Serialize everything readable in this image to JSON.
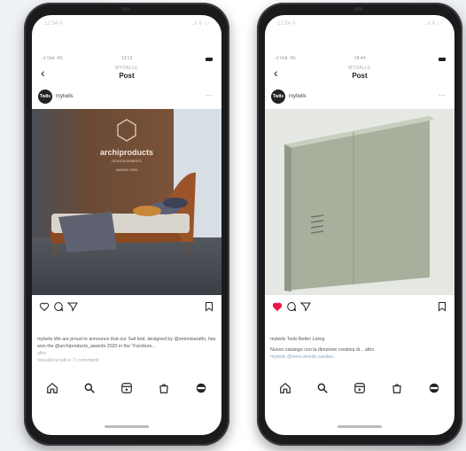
{
  "phones": [
    {
      "outer_status": {
        "left": "12:54 ⚲",
        "right": "..ıl ⚲ ▭"
      },
      "inner_status": {
        "left": "..ıl Vod. 4G",
        "center": "13:13"
      },
      "nav": {
        "account": "MYDALLE",
        "title": "Post"
      },
      "post": {
        "avatar_text": "Twils",
        "username": "mytwils",
        "photo_brand": "archiproducts",
        "photo_sub": "DESIGN AWARDS",
        "photo_badge": "AWARD 2020",
        "liked": false,
        "caption": "mytwils We are proud to announce that our Sail bed, designed by @zetonisarafin, has won the @archiproducts_awards 2020 in the \"Furniture...",
        "caption_more": "altro",
        "comments": "Visualizza tutti e 7 i commenti"
      },
      "tabs": [
        "home-icon",
        "search-icon",
        "reels-icon",
        "shop-icon",
        "profile-icon"
      ]
    },
    {
      "outer_status": {
        "left": "12:54 ⚲",
        "right": "..ıl ⚲ ▭"
      },
      "inner_status": {
        "left": "..ıl Vod. 4G",
        "center": "18:44"
      },
      "nav": {
        "account": "MYDALLE",
        "title": "Post"
      },
      "post": {
        "avatar_text": "Twils",
        "username": "mytwils",
        "liked": true,
        "likes_line": "mytwils Twils Better Living",
        "caption": "Nuovo catalogo con la direzione creativa di... altro",
        "caption2": "mytwils @novo.arredo.sanitari..."
      },
      "tabs": [
        "home-icon",
        "search-icon",
        "reels-icon",
        "shop-icon",
        "profile-icon"
      ]
    }
  ],
  "colors": {
    "like_red": "#ed1847",
    "phone_body": "#1b1b1d",
    "mention": "#8fa6c8"
  }
}
